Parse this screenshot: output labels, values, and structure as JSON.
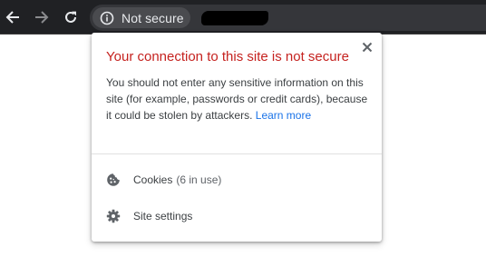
{
  "toolbar": {
    "back_icon": "back-arrow-icon",
    "forward_icon": "forward-arrow-icon",
    "reload_icon": "reload-icon",
    "site_chip": {
      "icon": "info-icon",
      "label": "Not secure"
    },
    "url_redacted": true
  },
  "popup": {
    "title": "Your connection to this site is not secure",
    "body": "You should not enter any sensitive information on this site (for example, passwords or credit cards), because it could be stolen by attackers.",
    "learn_more": "Learn more",
    "close_icon": "close-icon",
    "items": [
      {
        "icon": "cookie-icon",
        "label": "Cookies",
        "note": "(6 in use)"
      },
      {
        "icon": "gear-icon",
        "label": "Site settings"
      }
    ]
  },
  "colors": {
    "toolbar_bg": "#202124",
    "omnibox_bg": "#35363a",
    "chip_bg": "#4a4b4f",
    "warning_red": "#c5221f",
    "link_blue": "#1a73e8"
  }
}
